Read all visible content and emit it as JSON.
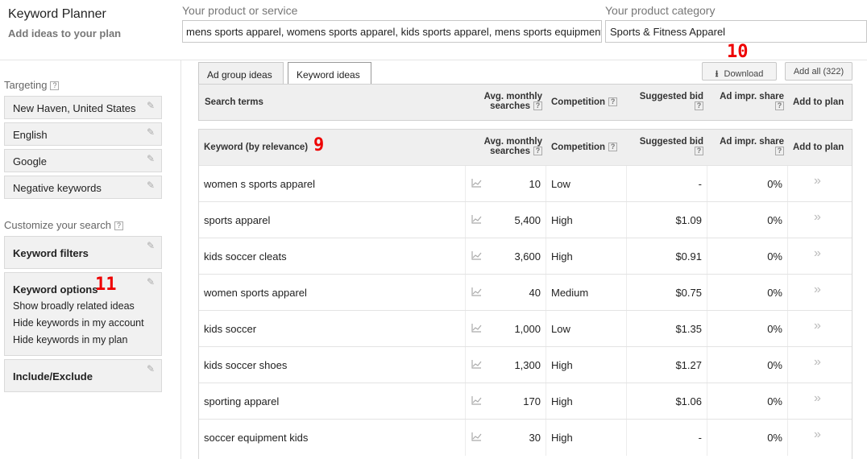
{
  "header": {
    "title": "Keyword Planner",
    "subtitle": "Add ideas to your plan",
    "product_label": "Your product or service",
    "product_value": "mens sports apparel, womens sports apparel, kids sports apparel, mens sports equipment, w",
    "category_label": "Your product category",
    "category_value": "Sports & Fitness Apparel"
  },
  "sidebar": {
    "targeting_heading": "Targeting",
    "help": "?",
    "targeting": [
      "New Haven, United States",
      "English",
      "Google",
      "Negative keywords"
    ],
    "customize_heading": "Customize your search",
    "keyword_filters": "Keyword filters",
    "keyword_options": {
      "title": "Keyword options",
      "lines": [
        "Show broadly related ideas",
        "Hide keywords in my account",
        "Hide keywords in my plan"
      ]
    },
    "include_exclude": "Include/Exclude"
  },
  "annotations": {
    "n9": "9",
    "n10": "10",
    "n11": "11"
  },
  "tabs": {
    "ad_group_ideas": "Ad group ideas",
    "keyword_ideas": "Keyword ideas"
  },
  "toolbar": {
    "download": "Download",
    "add_all": "Add all (322)"
  },
  "search_table": {
    "columns": [
      "Search terms",
      "Avg. monthly",
      "searches",
      "Competition",
      "Suggested bid",
      "Ad impr. share",
      "Add to plan"
    ]
  },
  "keyword_table": {
    "columns": [
      "Keyword (by relevance)",
      "Avg. monthly",
      "searches",
      "Competition",
      "Suggested bid",
      "Ad impr. share",
      "Add to plan"
    ],
    "rows": [
      {
        "keyword": "women s sports apparel",
        "searches": "10",
        "competition": "Low",
        "bid": "-",
        "share": "0%"
      },
      {
        "keyword": "sports apparel",
        "searches": "5,400",
        "competition": "High",
        "bid": "$1.09",
        "share": "0%"
      },
      {
        "keyword": "kids soccer cleats",
        "searches": "3,600",
        "competition": "High",
        "bid": "$0.91",
        "share": "0%"
      },
      {
        "keyword": "women sports apparel",
        "searches": "40",
        "competition": "Medium",
        "bid": "$0.75",
        "share": "0%"
      },
      {
        "keyword": "kids soccer",
        "searches": "1,000",
        "competition": "Low",
        "bid": "$1.35",
        "share": "0%"
      },
      {
        "keyword": "kids soccer shoes",
        "searches": "1,300",
        "competition": "High",
        "bid": "$1.27",
        "share": "0%"
      },
      {
        "keyword": "sporting apparel",
        "searches": "170",
        "competition": "High",
        "bid": "$1.06",
        "share": "0%"
      },
      {
        "keyword": "soccer equipment kids",
        "searches": "30",
        "competition": "High",
        "bid": "-",
        "share": "0%"
      }
    ]
  },
  "colors": {
    "annotation": "#e00000",
    "header_bg": "#efefef",
    "sidebar_box": "#f1f1f1"
  }
}
